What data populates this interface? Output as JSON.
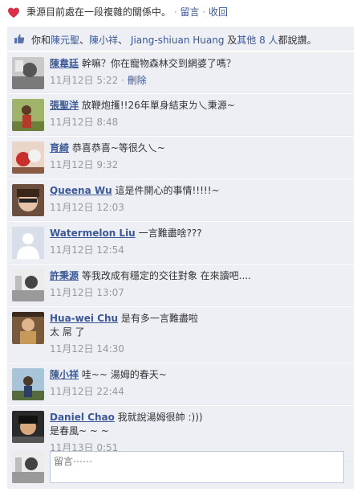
{
  "status": {
    "text": "秉源目前處在一段複雜的關係中。",
    "sep": " · ",
    "comment_label": "留言",
    "withdraw_label": "收回"
  },
  "likes": {
    "prefix": "你和",
    "person1": "陳元聖",
    "sep1": "、",
    "person2": "陳小祥",
    "sep2": "、",
    "person3": "Jiang-shiuan Huang",
    "middle": " 及",
    "others": "其他 8 人",
    "suffix": "都說讚。"
  },
  "comments": [
    {
      "author": "陳韋廷",
      "text": "幹嘛？你在寵物森林交到網婆了嗎？",
      "text2": "",
      "time": "11月12日 5:22",
      "delete": "刪除"
    },
    {
      "author": "張聖洋",
      "text": "放鞭炮擭!!26年單身結束ㄌ乀秉源~",
      "text2": "",
      "time": "11月12日 8:48",
      "delete": ""
    },
    {
      "author": "育綺",
      "text": "恭喜恭喜~等很久乀~",
      "text2": "",
      "time": "11月12日 9:32",
      "delete": ""
    },
    {
      "author": "Queena Wu",
      "text": "這是件開心的事情!!!!!~",
      "text2": "",
      "time": "11月12日 12:03",
      "delete": ""
    },
    {
      "author": "Watermelon Liu",
      "text": "一言難盡啥???",
      "text2": "",
      "time": "11月12日 12:54",
      "delete": ""
    },
    {
      "author": "許秉源",
      "text": "等我改成有穩定的交往對象 在來讀吧....",
      "text2": "",
      "time": "11月12日 13:07",
      "delete": ""
    },
    {
      "author": "Hua-wei Chu",
      "text": "是有多一言難盡啦",
      "text2": "太 屌 了",
      "time": "11月12日 14:30",
      "delete": ""
    },
    {
      "author": "陳小祥",
      "text": "哇~~ 湯姆的春天~",
      "text2": "",
      "time": "11月12日 22:44",
      "delete": ""
    },
    {
      "author": "Daniel Chao",
      "text": "我就說湯姆很帥 :)))",
      "text2": "是春風~ ~ ~",
      "time": "11月13日 0:51",
      "delete": ""
    }
  ],
  "composer": {
    "placeholder": "留言⋯⋯"
  },
  "colors": {
    "link": "#3b5998",
    "panel": "#edeff4",
    "heart": "#e0245e"
  }
}
